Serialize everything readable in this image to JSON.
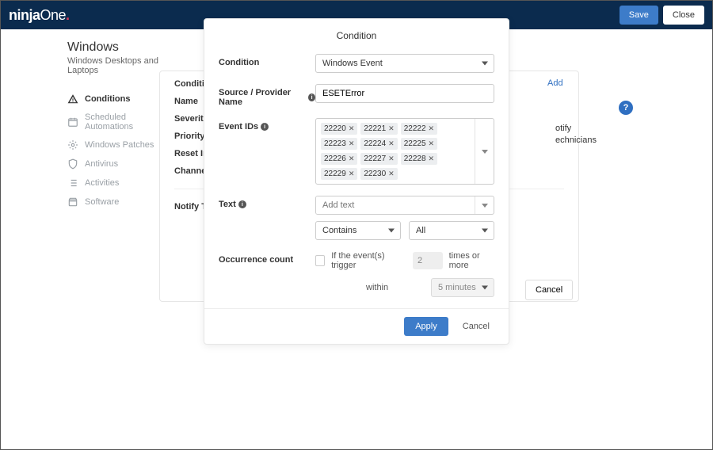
{
  "topbar": {
    "brand_main": "ninja",
    "brand_suffix": "One",
    "brand_dot": ".",
    "save_label": "Save",
    "close_label": "Close"
  },
  "page": {
    "title": "Windows",
    "subtitle": "Windows Desktops and Laptops",
    "nav": [
      {
        "label": "Conditions",
        "icon": "alert",
        "active": true
      },
      {
        "label": "Scheduled Automations",
        "icon": "calendar"
      },
      {
        "label": "Windows Patches",
        "icon": "patch"
      },
      {
        "label": "Antivirus",
        "icon": "shield"
      },
      {
        "label": "Activities",
        "icon": "list"
      },
      {
        "label": "Software",
        "icon": "package"
      }
    ],
    "card_rows": [
      "Condition",
      "Name",
      "Severity",
      "Priority",
      "Reset Interval",
      "Channels",
      "Notify Technicians"
    ],
    "add_label": "Add",
    "right_frag_1": "otify",
    "right_frag_2": "echnicians",
    "cancel_label": "Cancel",
    "help_char": "?"
  },
  "modal": {
    "title": "Condition",
    "condition_label": "Condition",
    "condition_value": "Windows Event",
    "source_label": "Source / Provider Name",
    "source_value": "ESETError",
    "eventids_label": "Event IDs",
    "event_ids": [
      "22220",
      "22221",
      "22222",
      "22223",
      "22224",
      "22225",
      "22226",
      "22227",
      "22228",
      "22229",
      "22230"
    ],
    "text_label": "Text",
    "text_placeholder": "Add text",
    "text_match": "Contains",
    "text_scope": "All",
    "occurrence_label": "Occurrence count",
    "occurrence_text1": "If the event(s) trigger",
    "occurrence_count": "2",
    "occurrence_text2": "times or more",
    "occurrence_within": "within",
    "occurrence_window": "5 minutes",
    "apply_label": "Apply",
    "cancel_label": "Cancel"
  }
}
